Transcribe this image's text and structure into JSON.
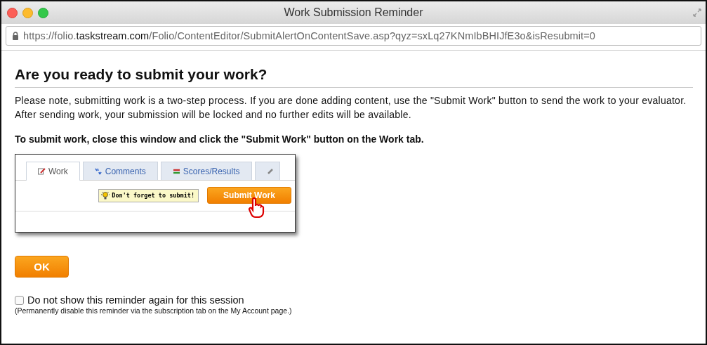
{
  "window": {
    "title": "Work Submission Reminder"
  },
  "address_bar": {
    "url": "https://folio.**taskstream.com**/Folio/ContentEditor/SubmitAlertOnContentSave.asp?qyz=sxLq27KNmIbBHIJfE3o&isResubmit=0"
  },
  "heading": "Are you ready to submit your work?",
  "paragraph": "Please note, submitting work is a two-step process. If you are done adding content, use the \"Submit Work\" button to send the work to your evaluator. After sending work, your submission will be locked and no further edits will be available.",
  "instruction": "To submit work, close this window and click the \"Submit Work\" button on the Work tab.",
  "example": {
    "tabs": [
      {
        "label": "Work",
        "kind": "work",
        "selected": true
      },
      {
        "label": "Comments",
        "kind": "comments",
        "selected": false
      },
      {
        "label": "Scores/Results",
        "kind": "scores",
        "selected": false
      },
      {
        "kind": "pencil",
        "selected": false
      }
    ],
    "tip": "Don't forget to submit!",
    "button": "Submit Work"
  },
  "ok_button": "OK",
  "reminder_checkbox": {
    "label": "Do not show this reminder again for this session",
    "checked": false
  },
  "note": "(Permanently disable this reminder via the subscription tab on the My Account page.)"
}
